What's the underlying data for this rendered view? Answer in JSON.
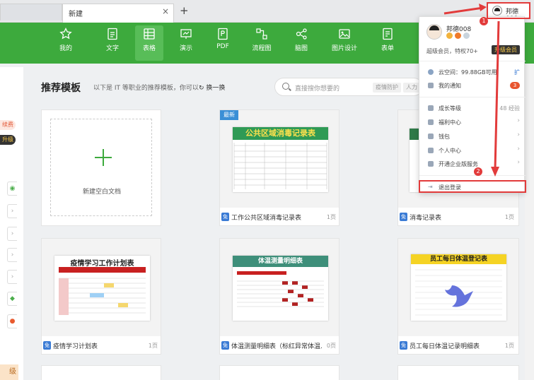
{
  "tabs": {
    "active": "新建",
    "close": "×",
    "add": "+"
  },
  "user": {
    "name": "邦德008"
  },
  "toolbar": {
    "items": [
      "我的",
      "文字",
      "表格",
      "演示",
      "PDF",
      "流程图",
      "脑图",
      "图片设计",
      "表单"
    ],
    "active": "表格"
  },
  "sidebar": {
    "labels": [
      "续费",
      "升级"
    ],
    "footer": "级"
  },
  "main": {
    "title": "推荐模板",
    "subtitle": "以下是 IT 等职业的推荐模板，你可以",
    "refresh": "换一换",
    "search_placeholder": "直接搜你想要的",
    "search_tags": [
      "疫情防护",
      "人力"
    ],
    "new_blank": "新建空白文档",
    "new_badge": "最新",
    "free_badge": "免"
  },
  "cards": [
    {
      "name": "工作公共区域消毒记录表",
      "pages": "1页",
      "thumb_title": "公共区域消毒记录表"
    },
    {
      "name": "消毒记录表",
      "pages": "1页"
    },
    {
      "name": "疫情学习计划表",
      "pages": "1页",
      "thumb_title": "疫情学习工作计划表"
    },
    {
      "name": "体温测量明细表（标红异常体温...",
      "pages": "0页",
      "thumb_title": "体温测量明细表"
    },
    {
      "name": "员工每日体温记录明细表",
      "pages": "1页",
      "thumb_title": "员工每日体温登记表"
    }
  ],
  "dropdown": {
    "name": "邦德008",
    "vip": "超级会员，特权70+",
    "upgrade": "升级会员",
    "cloud": "云空间：99.88GB可用",
    "cloud_action": "扩",
    "notice": "我的通知",
    "notice_count": "3",
    "level": "成长等级",
    "level_value": "48 经验",
    "welfare": "福利中心",
    "wallet": "钱包",
    "personal": "个人中心",
    "enterprise": "开通企业版服务",
    "logout": "退出登录"
  },
  "annotations": {
    "marker1": "1",
    "marker2": "2"
  },
  "colors": {
    "brand_green": "#3daa3d",
    "highlight_red": "#e23b3b"
  }
}
